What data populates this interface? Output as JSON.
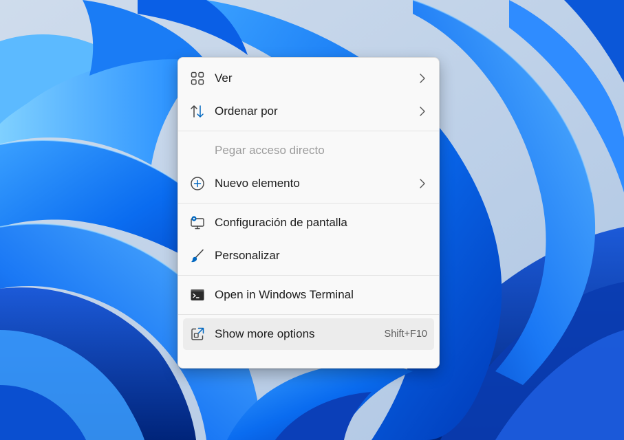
{
  "context_menu": {
    "items": [
      {
        "label": "Ver",
        "icon": "grid-icon",
        "has_submenu": true
      },
      {
        "label": "Ordenar por",
        "icon": "sort-arrows-icon",
        "has_submenu": true
      },
      {
        "label": "Pegar acceso directo",
        "icon": "none",
        "disabled": true
      },
      {
        "label": "Nuevo elemento",
        "icon": "plus-circle-icon",
        "has_submenu": true
      },
      {
        "label": "Configuración de pantalla",
        "icon": "display-settings-icon"
      },
      {
        "label": "Personalizar",
        "icon": "brush-icon"
      },
      {
        "label": "Open in Windows Terminal",
        "icon": "terminal-icon"
      },
      {
        "label": "Show more options",
        "icon": "expand-icon",
        "shortcut": "Shift+F10",
        "highlighted": true
      }
    ]
  },
  "colors": {
    "accent": "#0067c0",
    "menu_background": "#f9f9f9",
    "hover_background": "#ececec",
    "disabled_text": "#9c9c9c"
  }
}
